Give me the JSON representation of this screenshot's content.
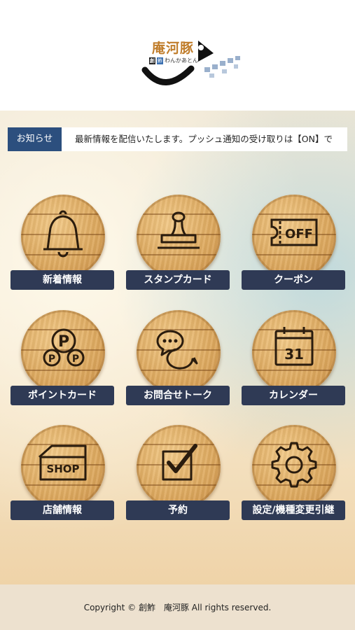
{
  "brand": {
    "title": "庵河豚",
    "badge_1": "創",
    "badge_2": "鮓",
    "subtitle": "わんかあとん"
  },
  "news": {
    "label": "お知らせ",
    "ticker": "最新情報を配信いたします。プッシュ通知の受け取りは【ON】で"
  },
  "menu": [
    {
      "label": "新着情報",
      "icon": "bell-icon"
    },
    {
      "label": "スタンプカード",
      "icon": "stamp-icon"
    },
    {
      "label": "クーポン",
      "icon": "coupon-icon",
      "icon_text": "OFF"
    },
    {
      "label": "ポイントカード",
      "icon": "points-icon",
      "icon_text": "P"
    },
    {
      "label": "お問合せトーク",
      "icon": "chat-bubbles-icon"
    },
    {
      "label": "カレンダー",
      "icon": "calendar-icon",
      "icon_text": "31"
    },
    {
      "label": "店舗情報",
      "icon": "shop-icon",
      "icon_text": "SHOP"
    },
    {
      "label": "予約",
      "icon": "checkbox-icon"
    },
    {
      "label": "設定/機種変更引継",
      "icon": "gear-icon"
    }
  ],
  "footer": {
    "copyright": "Copyright © 創鮓　庵河豚 All rights reserved."
  },
  "colors": {
    "news_label_bg": "#2c4f7e",
    "tile_label_bg": "#2f3a55",
    "brand_text": "#c07d2b",
    "footer_bg": "#ede1cf"
  }
}
